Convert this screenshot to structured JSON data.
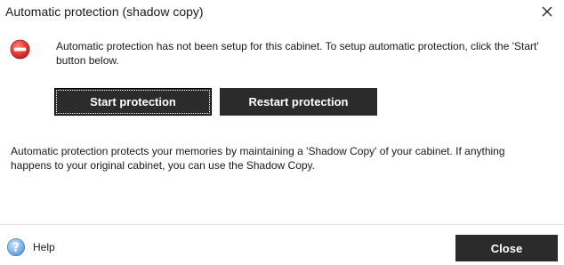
{
  "window": {
    "title": "Automatic protection (shadow copy)"
  },
  "message": {
    "text": "Automatic protection has not been setup for this cabinet.  To setup automatic protection, click the 'Start' button below."
  },
  "actions": {
    "start_label": "Start protection",
    "restart_label": "Restart protection"
  },
  "description": {
    "text": "Automatic protection protects your memories by maintaining a 'Shadow Copy' of your cabinet.  If anything happens to your original cabinet, you can use the Shadow Copy."
  },
  "footer": {
    "help_label": "Help",
    "close_label": "Close"
  },
  "icons": {
    "status": "stop-icon",
    "help": "question-icon",
    "close": "close-icon"
  },
  "colors": {
    "button_bg": "#2b2b2b",
    "stop_red": "#e53935",
    "help_blue": "#4a90d9"
  }
}
